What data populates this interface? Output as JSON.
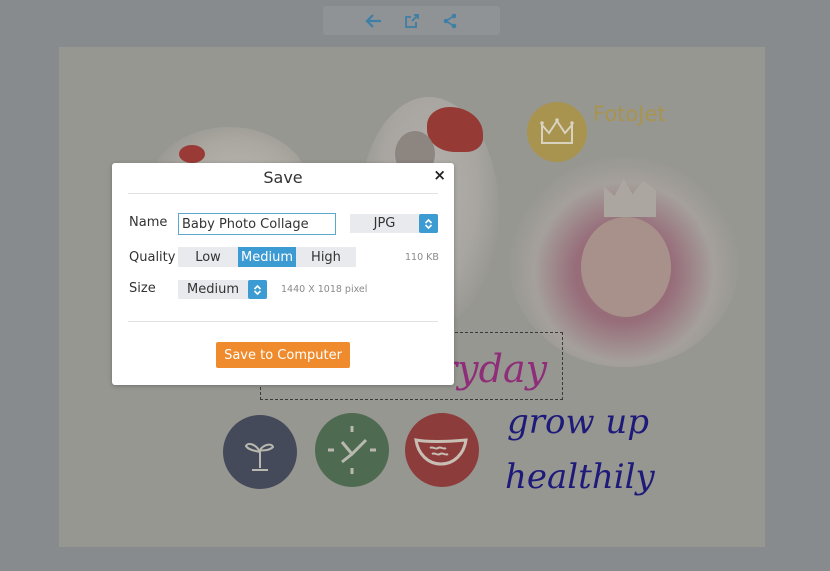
{
  "toolbar": {
    "buttons": [
      {
        "icon": "arrow-left-icon",
        "label": "Back"
      },
      {
        "icon": "open-external-icon",
        "label": "Open"
      },
      {
        "icon": "share-icon",
        "label": "Share"
      }
    ],
    "icon_color": "#3d7fa6"
  },
  "canvas": {
    "logo_text": "FotoJet",
    "text_everyday": "ryday",
    "text_line1": "grow up",
    "text_line2": "healthily",
    "badges": [
      "sprout-icon",
      "clock-icon",
      "fish-bowl-icon"
    ]
  },
  "dialog": {
    "title": "Save",
    "close_label": "×",
    "name_label": "Name",
    "name_value": "Baby Photo Collage",
    "format_value": "JPG",
    "quality_label": "Quality",
    "quality_options": [
      "Low",
      "Medium",
      "High"
    ],
    "quality_selected": "Medium",
    "file_size": "110 KB",
    "size_label": "Size",
    "size_value": "Medium",
    "dimensions": "1440 X 1018 pixel",
    "save_button": "Save to Computer"
  },
  "colors": {
    "accent_blue": "#3d9bd4",
    "save_orange": "#ef8b2c",
    "overlay": "#878b8d"
  }
}
